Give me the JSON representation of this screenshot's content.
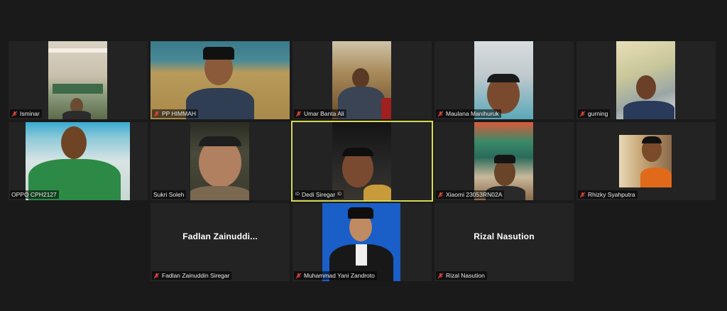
{
  "participants": [
    {
      "name": "Isminar",
      "muted": true
    },
    {
      "name": "PP HIMMAH",
      "muted": true
    },
    {
      "name": "Umar Banta Ali",
      "muted": true
    },
    {
      "name": "Maulana Manihuruk",
      "muted": true
    },
    {
      "name": "gurning",
      "muted": true
    },
    {
      "name": "OPPO CPH2127",
      "muted": false
    },
    {
      "name": "Sukri Soleh",
      "muted": false
    },
    {
      "name": "Dedi Siregar",
      "prefix": "ID",
      "suffix": "ID",
      "muted": false,
      "active_speaker": true
    },
    {
      "name": "Xiaomi 23053RN02A",
      "muted": true
    },
    {
      "name": "Rhizky Syahputra",
      "muted": true
    },
    {
      "name": "Fadlan Zainuddin Siregar",
      "display_name": "Fadlan  Zainuddi...",
      "muted": true,
      "video_off": true
    },
    {
      "name": "Muhammad Yani Zandroto",
      "muted": true
    },
    {
      "name": "Rizal Nasution",
      "display_name": "Rizal Nasution",
      "muted": true,
      "video_off": true
    }
  ],
  "colors": {
    "background": "#1a1a1a",
    "tile": "#232323",
    "active_border": "#d6d957",
    "muted_icon": "#e0463a"
  }
}
